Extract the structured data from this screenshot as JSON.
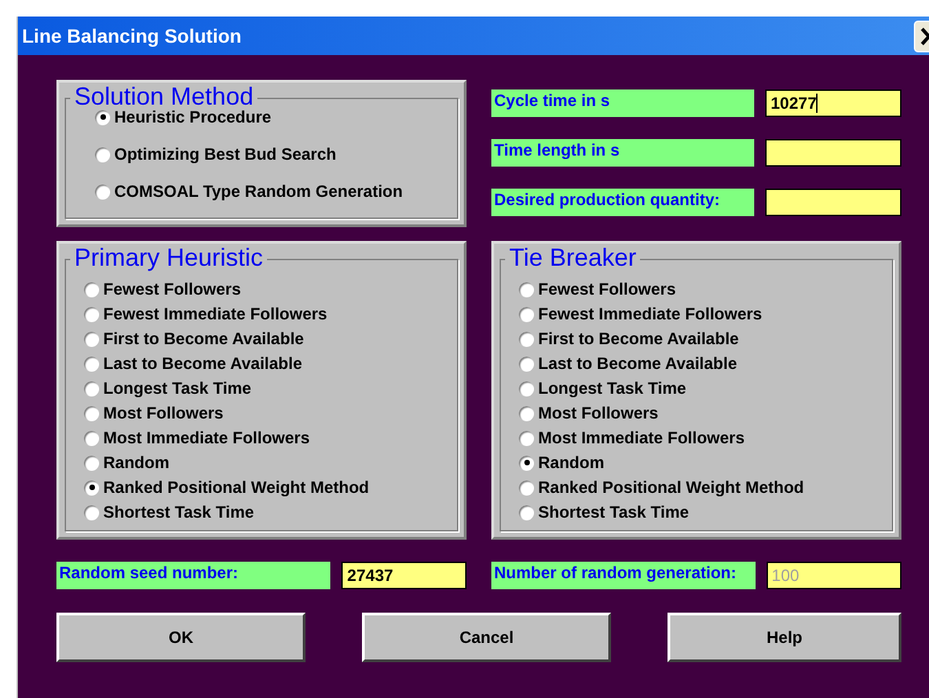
{
  "window": {
    "title": "Line Balancing Solution"
  },
  "solution_method": {
    "title": "Solution Method",
    "options": [
      {
        "label": "Heuristic Procedure",
        "selected": true
      },
      {
        "label": "Optimizing Best Bud Search",
        "selected": false
      },
      {
        "label": "COMSOAL Type Random Generation",
        "selected": false
      }
    ]
  },
  "parameters": [
    {
      "label": "Cycle time in s",
      "value": "10277",
      "focused": true
    },
    {
      "label": "Time length in s",
      "focused": false
    },
    {
      "label": "Desired production quantity:",
      "focused": false
    }
  ],
  "primary_heuristic": {
    "title": "Primary Heuristic",
    "options": [
      {
        "label": "Fewest Followers",
        "selected": false
      },
      {
        "label": "Fewest Immediate Followers",
        "selected": false
      },
      {
        "label": "First to Become Available",
        "selected": false
      },
      {
        "label": "Last to Become Available",
        "selected": false
      },
      {
        "label": "Longest Task Time",
        "selected": false
      },
      {
        "label": "Most Followers",
        "selected": false
      },
      {
        "label": "Most Immediate Followers",
        "selected": false
      },
      {
        "label": "Random",
        "selected": false
      },
      {
        "label": "Ranked Positional Weight Method",
        "selected": true
      },
      {
        "label": "Shortest Task Time",
        "selected": false
      }
    ]
  },
  "tie_breaker": {
    "title": "Tie Breaker",
    "options": [
      {
        "label": "Fewest Followers",
        "selected": false
      },
      {
        "label": "Fewest Immediate Followers",
        "selected": false
      },
      {
        "label": "First to Become Available",
        "selected": false
      },
      {
        "label": "Last to Become Available",
        "selected": false
      },
      {
        "label": "Longest Task Time",
        "selected": false
      },
      {
        "label": "Most Followers",
        "selected": false
      },
      {
        "label": "Most Immediate Followers",
        "selected": false
      },
      {
        "label": "Random",
        "selected": true
      },
      {
        "label": "Ranked Positional Weight Method",
        "selected": false
      },
      {
        "label": "Shortest Task Time",
        "selected": false
      }
    ]
  },
  "random_seed": {
    "label": "Random seed number:",
    "value": "27437",
    "disabled": false
  },
  "random_generations": {
    "label": "Number of random generation:",
    "value": "100",
    "disabled": true
  },
  "buttons": [
    "OK",
    "Cancel",
    "Help"
  ]
}
